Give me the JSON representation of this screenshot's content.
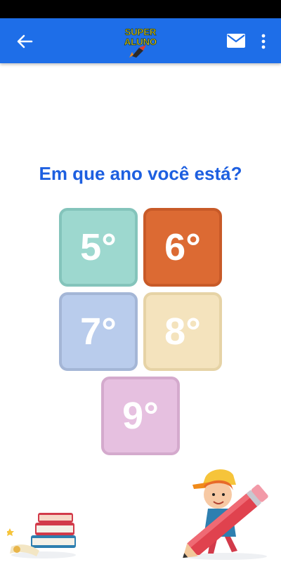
{
  "app_bar": {
    "logo_text_line1": "SUPER",
    "logo_text_line2": "ALUNO",
    "back_icon": "arrow-left-icon",
    "mail_icon": "envelope-icon",
    "more_icon": "more-vertical-icon",
    "color": "#1e6ee8"
  },
  "question": "Em que ano você está?",
  "grades": [
    {
      "label": "5°",
      "bg": "#9dd8cf",
      "border": "#84c4bb"
    },
    {
      "label": "6°",
      "bg": "#dc6a33",
      "border": "#c85a28"
    },
    {
      "label": "7°",
      "bg": "#b9ccec",
      "border": "#a4b6d6"
    },
    {
      "label": "8°",
      "bg": "#f4e3bd",
      "border": "#e6d3a6"
    },
    {
      "label": "9°",
      "bg": "#e6c0e0",
      "border": "#d4aacd"
    }
  ]
}
